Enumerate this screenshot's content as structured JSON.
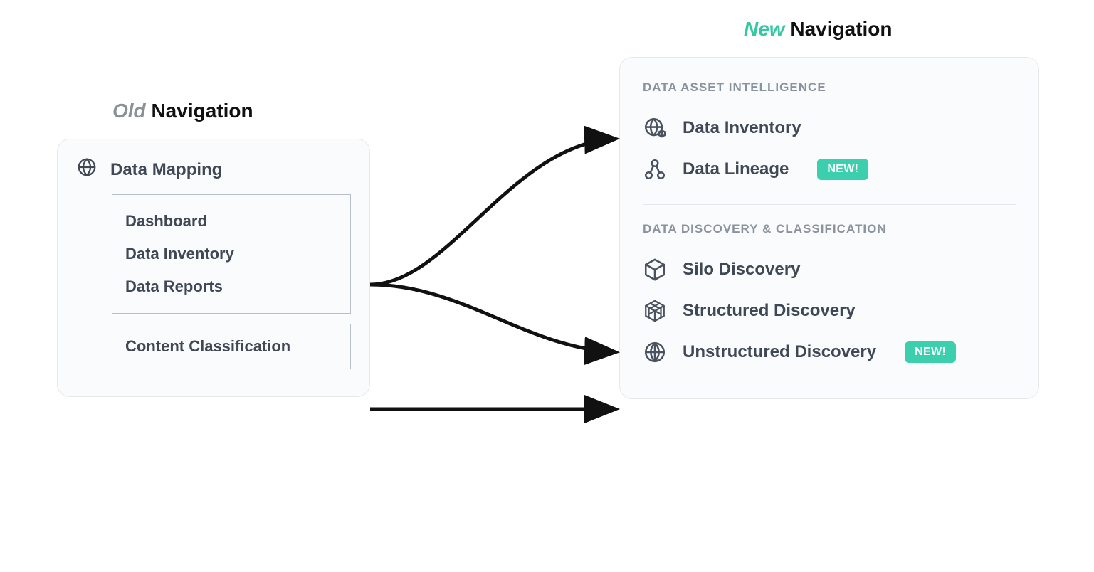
{
  "old": {
    "title_prefix": "Old",
    "title_rest": " Navigation",
    "heading": "Data Mapping",
    "group1": [
      "Dashboard",
      "Data Inventory",
      "Data Reports"
    ],
    "group2": [
      "Content Classification"
    ]
  },
  "new": {
    "title_prefix": "New",
    "title_rest": " Navigation",
    "section1_label": "DATA ASSET INTELLIGENCE",
    "section1_items": [
      {
        "label": "Data Inventory",
        "badge": null
      },
      {
        "label": "Data Lineage",
        "badge": "NEW!"
      }
    ],
    "section2_label": "DATA DISCOVERY & CLASSIFICATION",
    "section2_items": [
      {
        "label": "Silo Discovery",
        "badge": null
      },
      {
        "label": "Structured Discovery",
        "badge": null
      },
      {
        "label": "Unstructured Discovery",
        "badge": "NEW!"
      }
    ]
  }
}
